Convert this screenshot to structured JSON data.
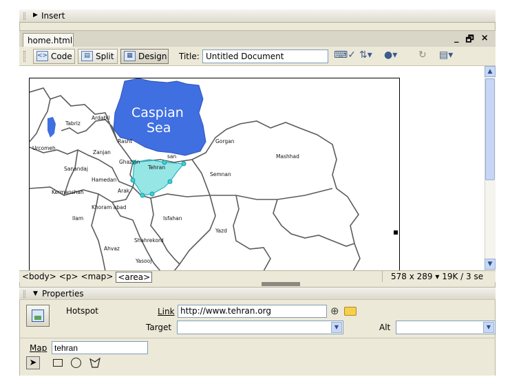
{
  "insert_panel": {
    "label": "Insert"
  },
  "document_tab": {
    "filename": "home.html"
  },
  "window_controls": {
    "minimize": "_",
    "restore": "🗗",
    "close": "×"
  },
  "toolbar": {
    "code_label": "Code",
    "split_label": "Split",
    "design_label": "Design",
    "title_label": "Title:",
    "title_value": "Untitled Document"
  },
  "map": {
    "sea_label_line1": "Caspian",
    "sea_label_line2": "Sea",
    "cities": [
      "Ardabil",
      "Tabriz",
      "Urcomeh",
      "Zanjan",
      "Rasht",
      "Gorgan",
      "Ghazvin",
      "Tehran",
      "Sanandaj",
      "Hamedan",
      "Semnan",
      "Mashhad",
      "Kermanshah",
      "Arak",
      "Khoram abad",
      "Ilam",
      "Isfahan",
      "Yazd",
      "Ahvaz",
      "Shahrekord",
      "Yasooj",
      "san"
    ]
  },
  "status_bar": {
    "tags": [
      "<body>",
      "<p>",
      "<map>",
      "<area>"
    ],
    "dimensions": "578 x 289",
    "download_size": "19K / 3 se"
  },
  "properties": {
    "header": "Properties",
    "element_type": "Hotspot",
    "link_label": "Link",
    "link_value": "http://www.tehran.org",
    "target_label": "Target",
    "target_value": "",
    "alt_label": "Alt",
    "alt_value": "",
    "map_label": "Map",
    "map_name": "tehran"
  },
  "colors": {
    "sea": "#3f6fe0",
    "hotspot": "#3fd2d2",
    "chrome": "#ece9d8"
  },
  "icons": [
    "grip-icon",
    "triangle-icon",
    "code-view-icon",
    "split-view-icon",
    "design-view-icon",
    "validate-icon",
    "file-transfer-icon",
    "browser-preview-icon",
    "refresh-icon",
    "view-options-icon",
    "point-to-file-icon",
    "folder-icon",
    "pointer-tool-icon",
    "rect-hotspot-icon",
    "oval-hotspot-icon",
    "polygon-hotspot-icon"
  ]
}
